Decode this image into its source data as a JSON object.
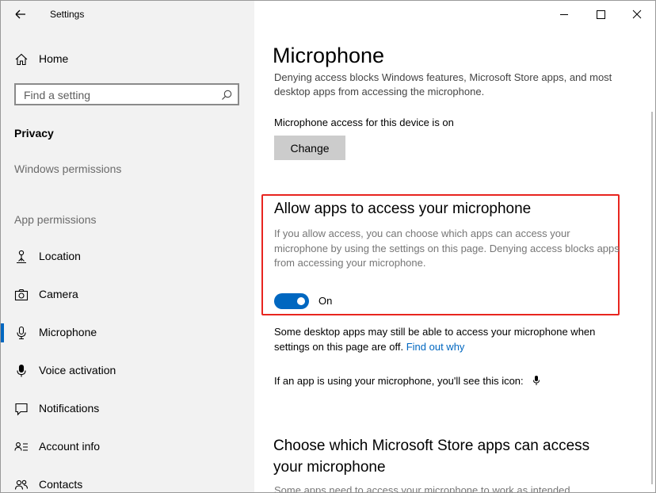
{
  "app": {
    "title": "Settings"
  },
  "sidebar": {
    "home_label": "Home",
    "search": {
      "placeholder": "Find a setting",
      "value": ""
    },
    "category": "Privacy",
    "windows_permissions": "Windows permissions",
    "app_permissions": "App permissions",
    "items": [
      {
        "label": "Location",
        "icon": "location-icon"
      },
      {
        "label": "Camera",
        "icon": "camera-icon"
      },
      {
        "label": "Microphone",
        "icon": "microphone-icon",
        "selected": true
      },
      {
        "label": "Voice activation",
        "icon": "voice-activation-icon"
      },
      {
        "label": "Notifications",
        "icon": "notifications-icon"
      },
      {
        "label": "Account info",
        "icon": "account-info-icon"
      },
      {
        "label": "Contacts",
        "icon": "contacts-icon"
      }
    ]
  },
  "main": {
    "title": "Microphone",
    "intro_faded": "Denying access blocks Windows features, Microsoft Store apps, and most desktop apps from accessing the microphone.",
    "device_access_text": "Microphone access for this device is on",
    "change_button": "Change",
    "allow_heading": "Allow apps to access your microphone",
    "allow_description": "If you allow access, you can choose which apps can access your microphone by using the settings on this page. Denying access blocks apps from accessing your microphone.",
    "toggle_state": "On",
    "desktop_note": "Some desktop apps may still be able to access your microphone when settings on this page are off.",
    "find_out_link": "Find out why",
    "icon_note": "If an app is using your microphone, you'll see this icon:",
    "choose_heading": "Choose which Microsoft Store apps can access your microphone",
    "cut_text": "Some apps need to access your microphone to work as intended."
  },
  "colors": {
    "accent": "#0067c0",
    "highlight_border": "#e8251f",
    "sidebar_bg": "#f2f2f2"
  }
}
